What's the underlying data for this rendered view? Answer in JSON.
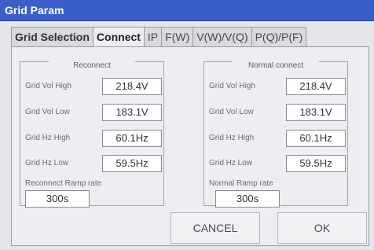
{
  "window": {
    "title": "Grid Param"
  },
  "tabs": [
    {
      "label": "Grid Selection"
    },
    {
      "label": "Connect"
    },
    {
      "label": "IP"
    },
    {
      "label": "F(W)"
    },
    {
      "label": "V(W)/V(Q)"
    },
    {
      "label": "P(Q)/P(F)"
    }
  ],
  "reconnect": {
    "title": "Reconnect",
    "rows": [
      {
        "label": "Grid Vol High",
        "value": "218.4V"
      },
      {
        "label": "Grid Vol Low",
        "value": "183.1V"
      },
      {
        "label": "Grid Hz High",
        "value": "60.1Hz"
      },
      {
        "label": "Grid Hz Low",
        "value": "59.5Hz"
      }
    ],
    "ramp_label": "Reconnect Ramp rate",
    "ramp_value": "300s"
  },
  "normal": {
    "title": "Normal connect",
    "rows": [
      {
        "label": "Grid Vol High",
        "value": "218.4V"
      },
      {
        "label": "Grid Vol Low",
        "value": "183.1V"
      },
      {
        "label": "Grid Hz High",
        "value": "60.1Hz"
      },
      {
        "label": "Grid Hz Low",
        "value": "59.5Hz"
      }
    ],
    "ramp_label": "Normal Ramp rate",
    "ramp_value": "300s"
  },
  "buttons": {
    "cancel": "CANCEL",
    "ok": "OK"
  },
  "colors": {
    "titlebar": "#3a5fc8",
    "panel": "#eeeef2"
  }
}
